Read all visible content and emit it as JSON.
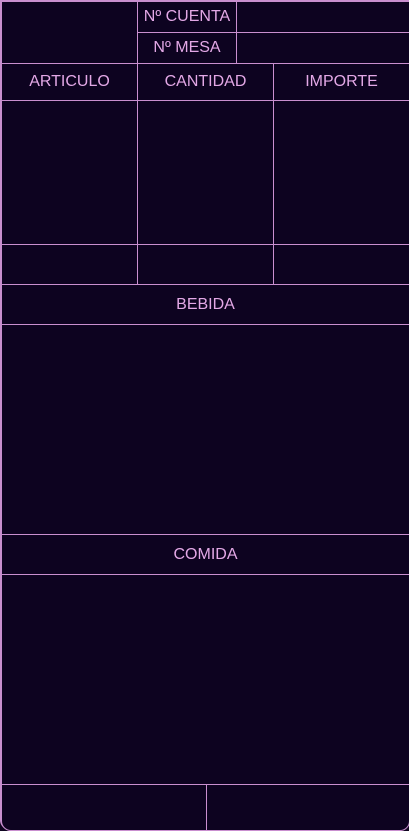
{
  "header": {
    "account_label": "Nº CUENTA",
    "table_label": "Nº MESA",
    "account_value": "",
    "table_value": ""
  },
  "order_table": {
    "columns": [
      "ARTICULO",
      "CANTIDAD",
      "IMPORTE"
    ]
  },
  "sections": {
    "drinks_label": "BEBIDA",
    "food_label": "COMIDA"
  },
  "colors": {
    "background": "#0d0320",
    "border": "#c98fcf",
    "text": "#e3a8e6"
  }
}
